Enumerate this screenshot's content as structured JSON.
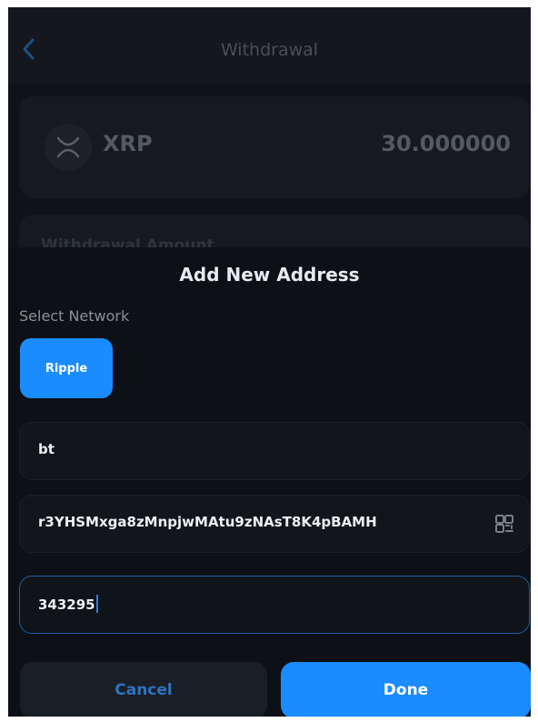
{
  "header": {
    "title": "Withdrawal",
    "back_icon": "chevron-left-icon"
  },
  "coin": {
    "icon": "xrp-icon",
    "name": "XRP",
    "amount": "30.000000"
  },
  "withdrawal_amount": {
    "label": "Withdrawal Amount"
  },
  "sheet": {
    "title": "Add New Address",
    "network_label": "Select Network",
    "networks": [
      "Ripple"
    ],
    "selected_network": "Ripple",
    "label_field": {
      "value": "bt"
    },
    "address_field": {
      "value": "r3YHSMxga8zMnpjwMAtu9zNAsT8K4pBAMH",
      "scan_icon": "qr-scan-icon"
    },
    "tag_field": {
      "value": "343295"
    },
    "cancel_label": "Cancel",
    "done_label": "Done"
  },
  "colors": {
    "accent": "#1a8cff",
    "background": "#0d1016",
    "field_background": "#12161c",
    "focused_border": "#1f5f9c"
  }
}
